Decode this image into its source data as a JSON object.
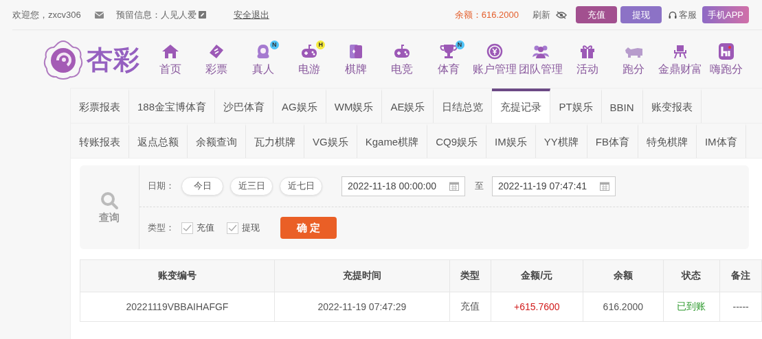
{
  "top_bar": {
    "welcome": "欢迎您，zxcv306",
    "reserved_info": "预留信息：人见人爱",
    "logout": "安全退出",
    "balance": "余额：616.2000",
    "refresh": "刷新",
    "deposit": "充值",
    "withdraw": "提现",
    "service": "客服",
    "app": "手机APP"
  },
  "logo": {
    "text": "杏彩"
  },
  "nav": [
    {
      "label": "首页"
    },
    {
      "label": "彩票"
    },
    {
      "label": "真人",
      "badge": {
        "text": "N",
        "color": "#4fc3f7"
      }
    },
    {
      "label": "电游",
      "badge": {
        "text": "H",
        "color": "#f5ea3b"
      }
    },
    {
      "label": "棋牌"
    },
    {
      "label": "电竞"
    },
    {
      "label": "体育",
      "badge": {
        "text": "N",
        "color": "#4fc3f7"
      }
    },
    {
      "label": "账户管理"
    },
    {
      "label": "团队管理"
    },
    {
      "label": "活动"
    },
    {
      "label": "跑分"
    },
    {
      "label": "金鼎财富"
    },
    {
      "label": "嗨跑分"
    }
  ],
  "tabs": [
    [
      {
        "label": "彩票报表",
        "selected": false
      },
      {
        "label": "188金宝博体育",
        "selected": false
      },
      {
        "label": "沙巴体育",
        "selected": false
      },
      {
        "label": "AG娱乐",
        "selected": false
      },
      {
        "label": "WM娱乐",
        "selected": false
      },
      {
        "label": "AE娱乐",
        "selected": false
      },
      {
        "label": "日结总览",
        "selected": false
      },
      {
        "label": "充提记录",
        "selected": true
      },
      {
        "label": "PT娱乐",
        "selected": false
      },
      {
        "label": "BBIN",
        "selected": false
      },
      {
        "label": "账变报表",
        "selected": false
      }
    ],
    [
      {
        "label": "转账报表",
        "selected": false
      },
      {
        "label": "返点总额",
        "selected": false
      },
      {
        "label": "余额查询",
        "selected": false
      },
      {
        "label": "瓦力棋牌",
        "selected": false
      },
      {
        "label": "VG娱乐",
        "selected": false
      },
      {
        "label": "Kgame棋牌",
        "selected": false
      },
      {
        "label": "CQ9娱乐",
        "selected": false
      },
      {
        "label": "IM娱乐",
        "selected": false
      },
      {
        "label": "YY棋牌",
        "selected": false
      },
      {
        "label": "FB体育",
        "selected": false
      },
      {
        "label": "特免棋牌",
        "selected": false
      },
      {
        "label": "IM体育",
        "selected": false
      }
    ]
  ],
  "query": {
    "label": "查询",
    "date_label": "日期：",
    "quick_dates": [
      "今日",
      "近三日",
      "近七日"
    ],
    "start": "2022-11-18 00:00:00",
    "to": "至",
    "end": "2022-11-19 07:47:41",
    "type_label": "类型：",
    "types": [
      {
        "label": "充值",
        "checked": true
      },
      {
        "label": "提现",
        "checked": true
      }
    ],
    "confirm": "确 定"
  },
  "table": {
    "columns": [
      "账变编号",
      "充提时间",
      "类型",
      "金额/元",
      "余额",
      "状态",
      "备注"
    ],
    "rows": [
      {
        "cells": [
          "20221119VBBAIHAFGF",
          "2022-11-19 07:47:29",
          "充值",
          "+615.7600",
          "616.2000",
          "已到账",
          "-----"
        ]
      }
    ]
  }
}
